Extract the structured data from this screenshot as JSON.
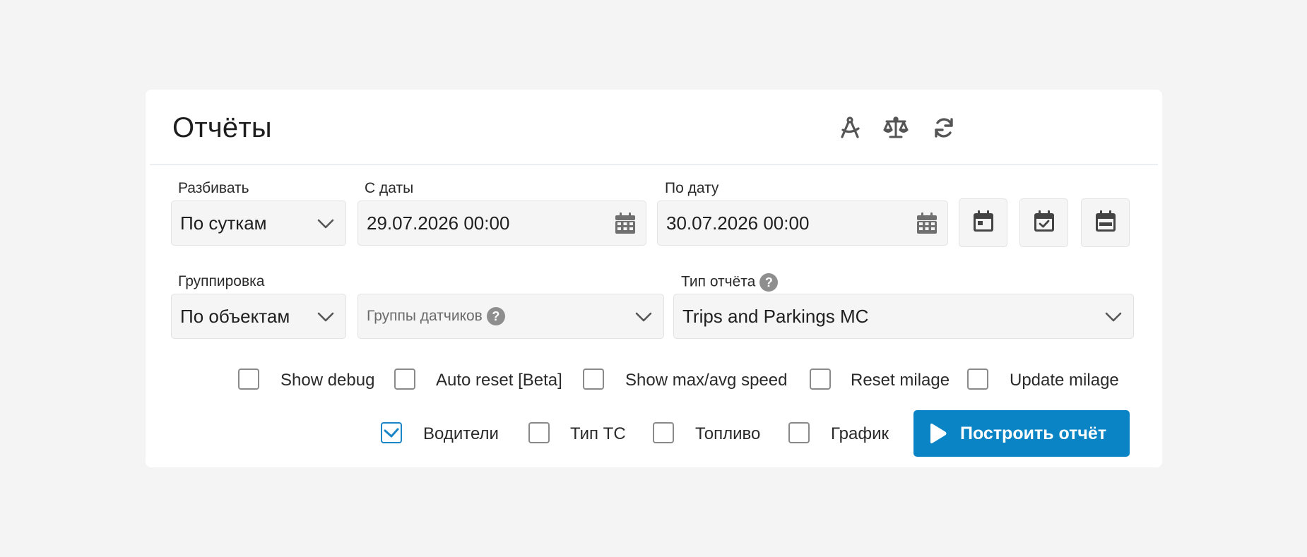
{
  "header": {
    "title": "Отчёты",
    "icons": [
      "compass-icon",
      "scales-icon",
      "refresh-icon"
    ]
  },
  "split": {
    "label": "Разбивать",
    "value": "По суткам"
  },
  "date_from": {
    "label": "С даты",
    "value": "29.07.2026 00:00"
  },
  "date_to": {
    "label": "По дату",
    "value": "30.07.2026 00:00"
  },
  "quick_dates": [
    "calendar-day-icon",
    "calendar-check-icon",
    "calendar-range-icon"
  ],
  "grouping": {
    "label": "Группировка",
    "value": "По объектам"
  },
  "sensor_groups": {
    "placeholder": "Группы датчиков"
  },
  "report_type": {
    "label": "Тип отчёта",
    "value": "Trips and Parkings MC"
  },
  "options_row1": [
    {
      "label": "Show debug",
      "checked": false
    },
    {
      "label": "Auto reset [Beta]",
      "checked": false
    },
    {
      "label": "Show max/avg speed",
      "checked": false
    },
    {
      "label": "Reset milage",
      "checked": false
    },
    {
      "label": "Update milage",
      "checked": false
    }
  ],
  "options_row2": [
    {
      "label": "Водители",
      "checked": true
    },
    {
      "label": "Тип ТС",
      "checked": false
    },
    {
      "label": "Топливо",
      "checked": false
    },
    {
      "label": "График",
      "checked": false
    }
  ],
  "run_button": {
    "label": "Построить отчёт"
  },
  "colors": {
    "accent": "#0b84c6",
    "icon": "#555555",
    "page_bg": "#f4f4f4"
  }
}
